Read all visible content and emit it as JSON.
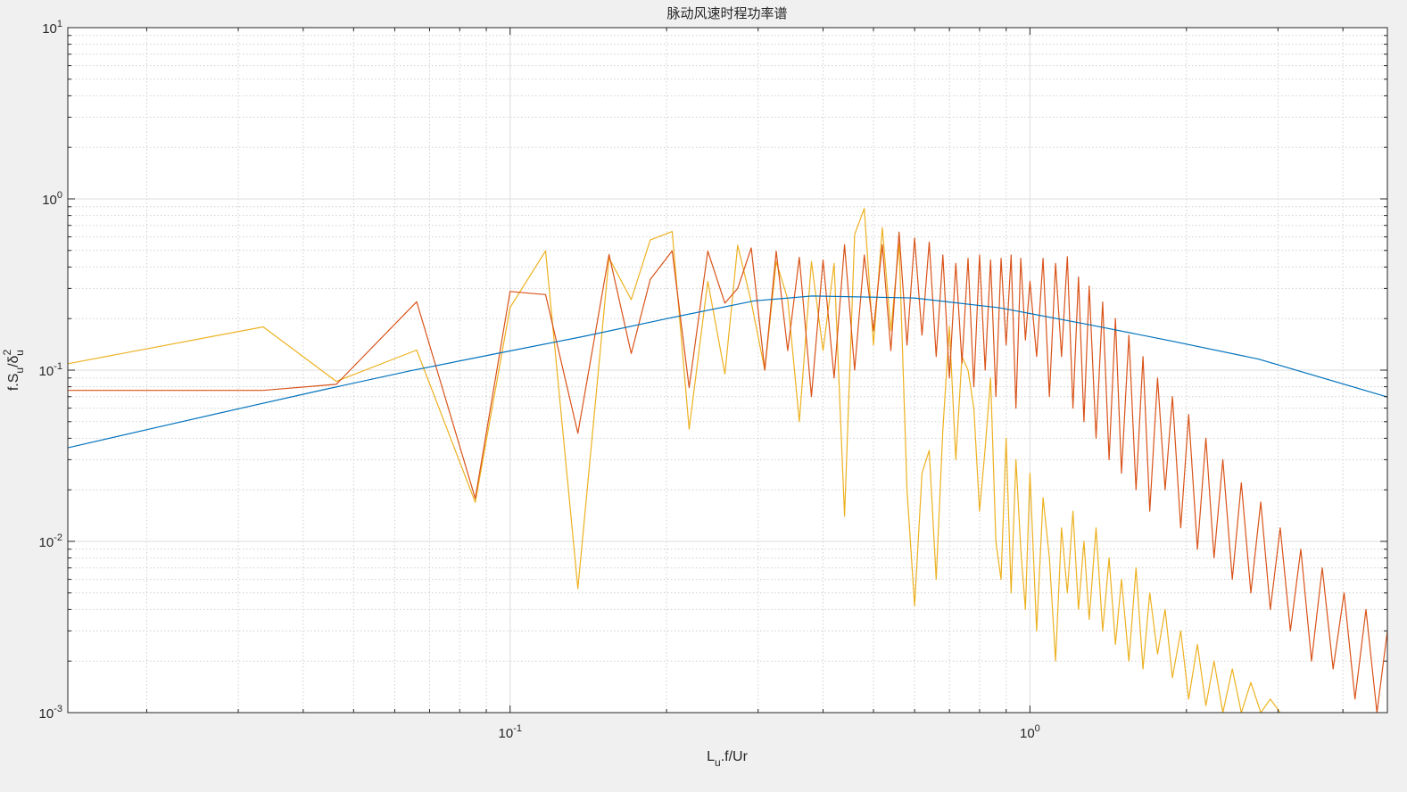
{
  "chart_data": {
    "type": "line",
    "title": "脉动风速时程功率谱",
    "xlabel": {
      "main": "L",
      "sub": "u",
      "rest": ".f/Ur"
    },
    "ylabel": {
      "p1": "f.S",
      "sub1": "u",
      "p2": "/δ",
      "sup": "2",
      "sub2": "u"
    },
    "xscale": "log",
    "yscale": "log",
    "xlim": [
      0.0141,
      4.87
    ],
    "ylim": [
      0.001,
      10
    ],
    "x_tick_labels": [
      {
        "value": 0.1,
        "base": "10",
        "exp": "-1"
      },
      {
        "value": 1,
        "base": "10",
        "exp": "0"
      }
    ],
    "y_tick_labels": [
      {
        "value": 0.001,
        "base": "10",
        "exp": "-3"
      },
      {
        "value": 0.01,
        "base": "10",
        "exp": "-2"
      },
      {
        "value": 0.1,
        "base": "10",
        "exp": "-1"
      },
      {
        "value": 1,
        "base": "10",
        "exp": "0"
      },
      {
        "value": 10,
        "base": "10",
        "exp": "1"
      }
    ],
    "grid": true,
    "minor_grid": true,
    "legend": "none",
    "colors": {
      "blue": "#0072bd",
      "orange": "#d95319",
      "yellow": "#edb120",
      "axes_bg": "#ffffff",
      "figure_bg": "#f0f0f0",
      "grid_major": "#dcdcdc",
      "grid_minor": "#d0d0d0"
    },
    "series": [
      {
        "color": "#0072bd",
        "x": [
          0.0141,
          0.0206,
          0.0301,
          0.0441,
          0.0645,
          0.0943,
          0.138,
          0.202,
          0.295,
          0.381,
          0.599,
          0.876,
          1.28,
          1.87,
          2.75,
          4.87
        ],
        "y": [
          0.0352,
          0.0458,
          0.0596,
          0.0773,
          0.0993,
          0.125,
          0.157,
          0.201,
          0.254,
          0.271,
          0.264,
          0.231,
          0.186,
          0.148,
          0.116,
          0.0697
        ]
      },
      {
        "color": "#d95319",
        "x": [
          0.0141,
          0.0335,
          0.0463,
          0.0661,
          0.0857,
          0.1,
          0.117,
          0.135,
          0.155,
          0.171,
          0.186,
          0.205,
          0.221,
          0.24,
          0.259,
          0.274,
          0.291,
          0.309,
          0.325,
          0.342,
          0.36,
          0.38,
          0.4,
          0.42,
          0.44,
          0.46,
          0.48,
          0.5,
          0.52,
          0.54,
          0.56,
          0.58,
          0.6,
          0.62,
          0.64,
          0.66,
          0.68,
          0.7,
          0.72,
          0.74,
          0.76,
          0.78,
          0.8,
          0.82,
          0.84,
          0.86,
          0.88,
          0.9,
          0.92,
          0.94,
          0.96,
          0.98,
          1.0,
          1.03,
          1.06,
          1.09,
          1.12,
          1.15,
          1.18,
          1.21,
          1.24,
          1.27,
          1.3,
          1.34,
          1.38,
          1.42,
          1.46,
          1.5,
          1.55,
          1.6,
          1.65,
          1.7,
          1.76,
          1.82,
          1.88,
          1.95,
          2.02,
          2.1,
          2.18,
          2.26,
          2.35,
          2.45,
          2.55,
          2.66,
          2.78,
          2.9,
          3.03,
          3.17,
          3.32,
          3.48,
          3.65,
          3.83,
          4.02,
          4.22,
          4.43,
          4.65,
          4.87
        ],
        "y": [
          0.0762,
          0.0762,
          0.0826,
          0.251,
          0.0178,
          0.288,
          0.276,
          0.0428,
          0.474,
          0.125,
          0.338,
          0.497,
          0.079,
          0.495,
          0.246,
          0.3,
          0.517,
          0.1,
          0.495,
          0.13,
          0.456,
          0.07,
          0.44,
          0.09,
          0.54,
          0.1,
          0.47,
          0.17,
          0.54,
          0.13,
          0.64,
          0.14,
          0.59,
          0.16,
          0.56,
          0.12,
          0.47,
          0.09,
          0.42,
          0.11,
          0.45,
          0.08,
          0.47,
          0.1,
          0.44,
          0.07,
          0.45,
          0.14,
          0.47,
          0.06,
          0.45,
          0.15,
          0.33,
          0.12,
          0.45,
          0.07,
          0.42,
          0.12,
          0.46,
          0.06,
          0.35,
          0.05,
          0.31,
          0.04,
          0.25,
          0.03,
          0.2,
          0.025,
          0.16,
          0.02,
          0.12,
          0.015,
          0.09,
          0.02,
          0.07,
          0.012,
          0.055,
          0.009,
          0.04,
          0.008,
          0.03,
          0.006,
          0.022,
          0.005,
          0.017,
          0.004,
          0.012,
          0.003,
          0.009,
          0.002,
          0.007,
          0.0018,
          0.005,
          0.0012,
          0.004,
          0.001,
          0.003
        ]
      },
      {
        "color": "#edb120",
        "x": [
          0.0141,
          0.0335,
          0.0463,
          0.0661,
          0.0857,
          0.1,
          0.117,
          0.135,
          0.155,
          0.171,
          0.186,
          0.205,
          0.221,
          0.24,
          0.259,
          0.274,
          0.291,
          0.309,
          0.325,
          0.342,
          0.36,
          0.38,
          0.4,
          0.42,
          0.44,
          0.46,
          0.48,
          0.5,
          0.52,
          0.54,
          0.56,
          0.58,
          0.6,
          0.62,
          0.64,
          0.66,
          0.68,
          0.7,
          0.72,
          0.74,
          0.76,
          0.78,
          0.8,
          0.82,
          0.84,
          0.86,
          0.88,
          0.9,
          0.92,
          0.94,
          0.96,
          0.98,
          1.0,
          1.03,
          1.06,
          1.09,
          1.12,
          1.15,
          1.18,
          1.21,
          1.24,
          1.27,
          1.3,
          1.34,
          1.38,
          1.42,
          1.46,
          1.5,
          1.55,
          1.6,
          1.65,
          1.7,
          1.76,
          1.82,
          1.88,
          1.95,
          2.02,
          2.1,
          2.18,
          2.26,
          2.35,
          2.45,
          2.55,
          2.66,
          2.78,
          2.9,
          3.03
        ],
        "y": [
          0.109,
          0.179,
          0.086,
          0.131,
          0.0169,
          0.232,
          0.497,
          0.0053,
          0.452,
          0.258,
          0.575,
          0.645,
          0.0452,
          0.33,
          0.095,
          0.536,
          0.25,
          0.1,
          0.43,
          0.26,
          0.05,
          0.43,
          0.13,
          0.42,
          0.014,
          0.62,
          0.88,
          0.14,
          0.68,
          0.17,
          0.55,
          0.02,
          0.0042,
          0.025,
          0.034,
          0.006,
          0.045,
          0.18,
          0.03,
          0.12,
          0.1,
          0.06,
          0.015,
          0.035,
          0.09,
          0.01,
          0.006,
          0.04,
          0.005,
          0.03,
          0.009,
          0.004,
          0.025,
          0.003,
          0.018,
          0.008,
          0.002,
          0.012,
          0.005,
          0.015,
          0.004,
          0.01,
          0.0035,
          0.012,
          0.003,
          0.008,
          0.0025,
          0.006,
          0.002,
          0.007,
          0.0018,
          0.005,
          0.0022,
          0.004,
          0.0016,
          0.003,
          0.0012,
          0.0025,
          0.0011,
          0.002,
          0.001,
          0.0018,
          0.001,
          0.0015,
          0.001,
          0.0012,
          0.001
        ]
      }
    ]
  }
}
